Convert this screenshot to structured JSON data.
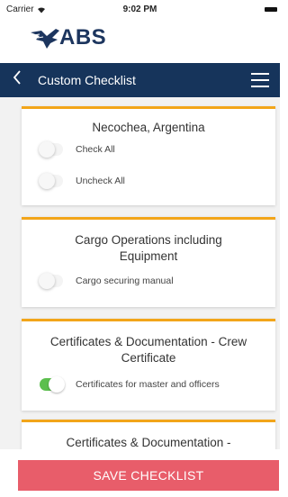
{
  "status_bar": {
    "carrier": "Carrier",
    "time": "9:02 PM"
  },
  "logo": {
    "text": "ABS"
  },
  "nav": {
    "title": "Custom Checklist"
  },
  "cards": [
    {
      "title": "Necochea, Argentina",
      "items": [
        {
          "label": "Check All",
          "on": false
        },
        {
          "label": "Uncheck All",
          "on": false
        }
      ]
    },
    {
      "title": "Cargo Operations including Equipment",
      "items": [
        {
          "label": "Cargo securing manual",
          "on": false
        }
      ]
    },
    {
      "title": "Certificates & Documentation - Crew Certificate",
      "items": [
        {
          "label": "Certificates for master and officers",
          "on": true
        }
      ]
    },
    {
      "title": "Certificates & Documentation -",
      "items": []
    }
  ],
  "save_button": {
    "label": "SAVE CHECKLIST"
  },
  "colors": {
    "nav": "#16345b",
    "accent": "#f2a51a",
    "save": "#e85d6a",
    "toggle_on": "#5cbf4e"
  }
}
